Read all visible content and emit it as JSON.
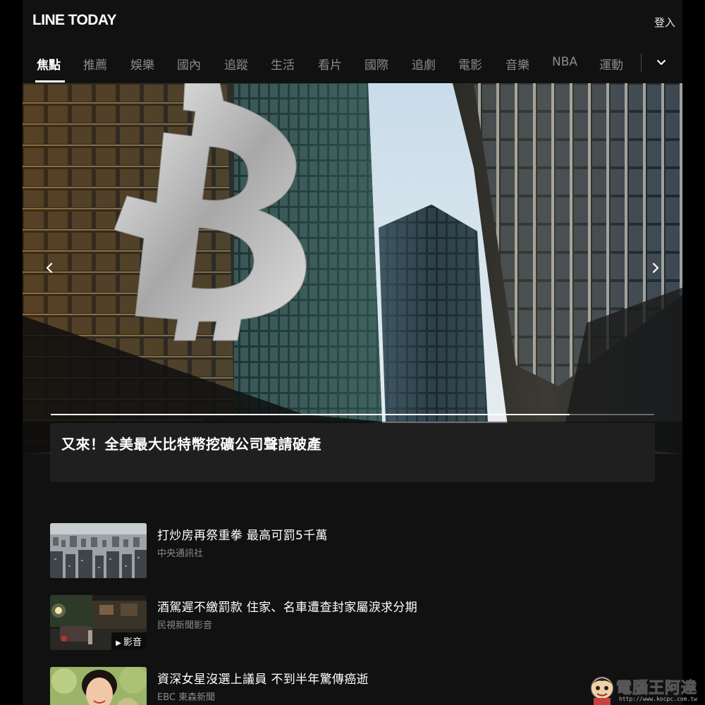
{
  "header": {
    "logo": "LINE TODAY",
    "login_label": "登入"
  },
  "nav": {
    "tabs": [
      {
        "label": "焦點",
        "active": true
      },
      {
        "label": "推薦",
        "active": false
      },
      {
        "label": "娛樂",
        "active": false
      },
      {
        "label": "國內",
        "active": false
      },
      {
        "label": "追蹤",
        "active": false
      },
      {
        "label": "生活",
        "active": false
      },
      {
        "label": "看片",
        "active": false
      },
      {
        "label": "國際",
        "active": false
      },
      {
        "label": "追劇",
        "active": false
      },
      {
        "label": "電影",
        "active": false
      },
      {
        "label": "音樂",
        "active": false
      },
      {
        "label": "NBA",
        "active": false
      },
      {
        "label": "運動",
        "active": false
      }
    ],
    "more_icon": "chevron-down-icon"
  },
  "hero": {
    "headline": "又來！全美最大比特幣挖礦公司聲請破產",
    "prev_icon": "chevron-left-icon",
    "next_icon": "chevron-right-icon",
    "progress": 0.86
  },
  "news": [
    {
      "title": "打炒房再祭重拳 最高可罰5千萬",
      "source": "中央通訊社",
      "thumb": "city-aerial",
      "video_label": ""
    },
    {
      "title": "酒駕遲不繳罰款 住家、名車遭查封家屬淚求分期",
      "source": "民視新聞影音",
      "thumb": "night-street",
      "video_label": "影音"
    },
    {
      "title": "資深女星沒選上議員 不到半年驚傳癌逝",
      "source": "EBC 東森新聞",
      "thumb": "portrait",
      "video_label": ""
    }
  ],
  "watermark": {
    "text": "電腦王阿達",
    "url": "http://www.kocpc.com.tw"
  },
  "colors": {
    "background": "#111111",
    "active_tab": "#ffffff",
    "inactive_tab": "#8a8a8a",
    "card": "#1f1f1f"
  }
}
